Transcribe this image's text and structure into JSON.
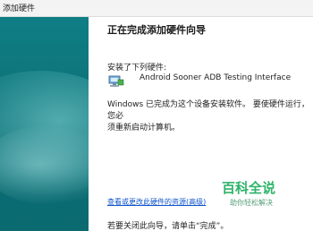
{
  "window": {
    "title": "添加硬件"
  },
  "wizard": {
    "heading": "正在完成添加硬件向导",
    "installed_label": "安装了下列硬件:",
    "device_icon": "network-adapter-icon",
    "device_name": "Android Sooner ADB Testing Interface",
    "finish_line1": "Windows 已完成为这个设备安装软件。 要使硬件运行，您必",
    "finish_line2": "须重新启动计算机。",
    "view_link": "查看或更改此硬件的资源(高级)",
    "close_hint": "若要关闭此向导，请单击“完成”。"
  },
  "watermark": {
    "name": "百科全说",
    "tagline": "助你轻松解决",
    "color": "#2fb36b"
  },
  "colors": {
    "side_panel": "#0f7e84",
    "link": "#1155cc"
  }
}
